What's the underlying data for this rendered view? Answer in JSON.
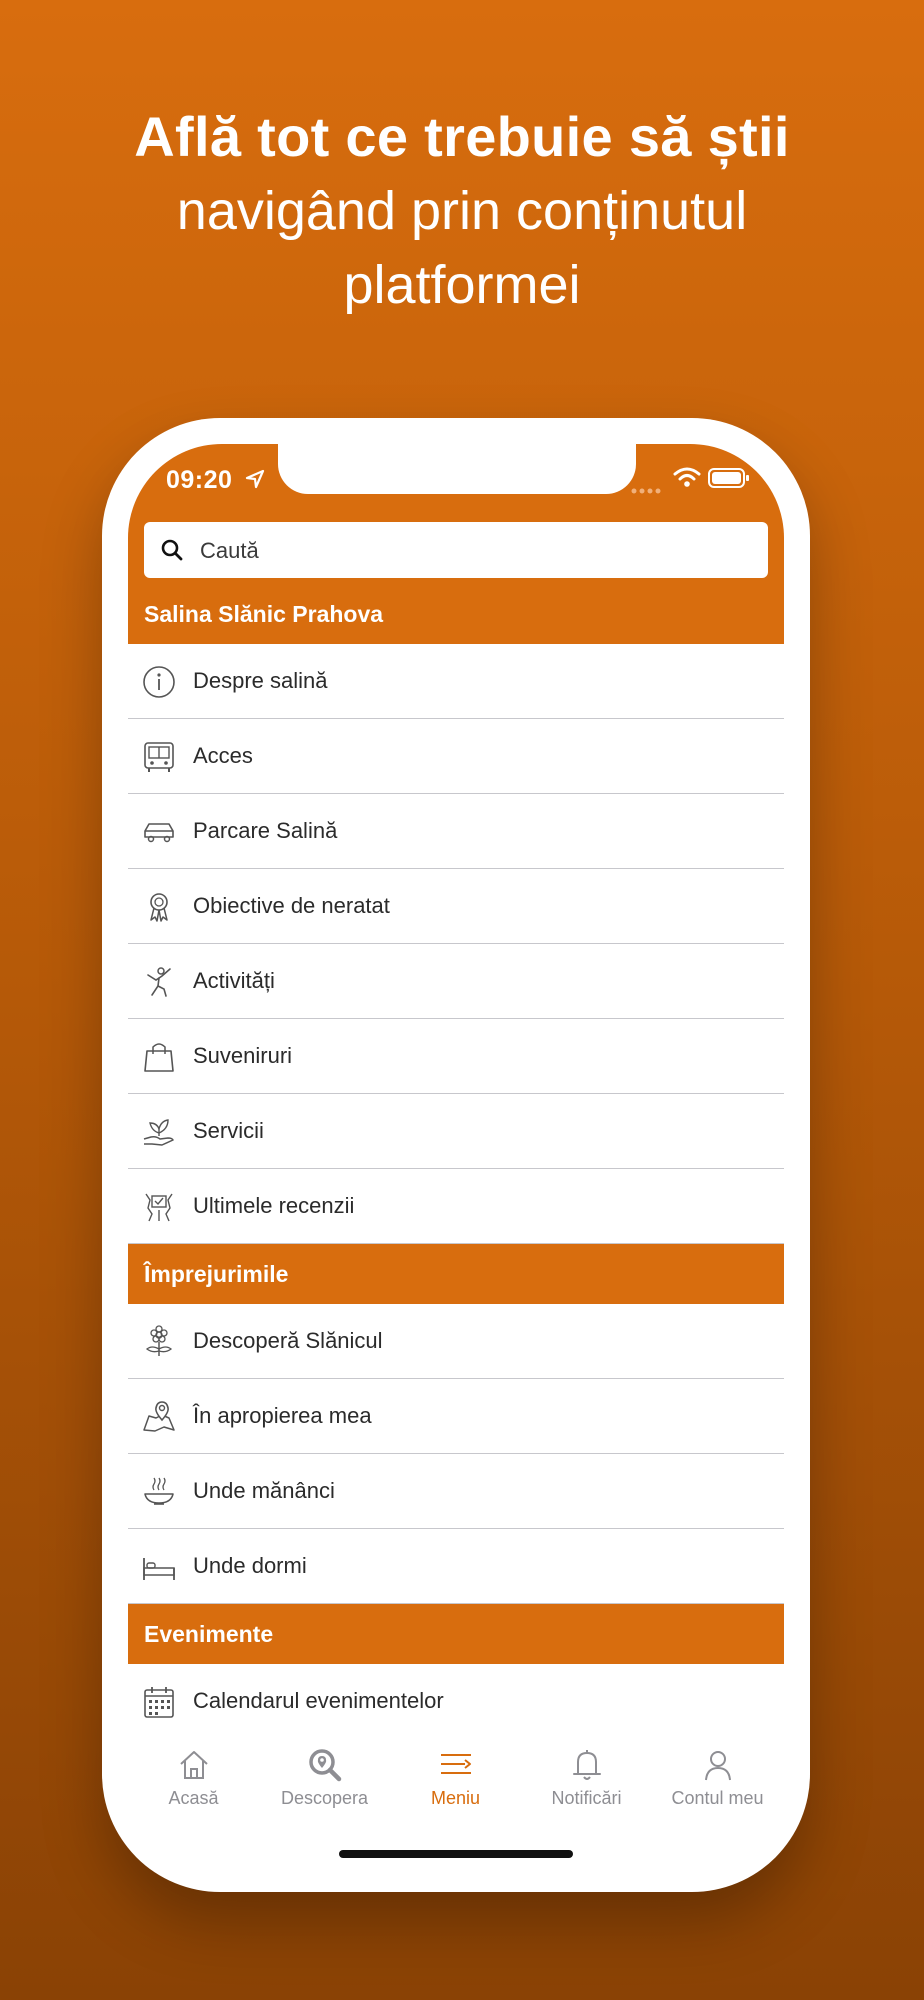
{
  "headline": {
    "line1": "Află tot ce trebuie să știi",
    "line2": "navigând prin conținutul",
    "line3": "platformei"
  },
  "status_bar": {
    "time": "09:20"
  },
  "search": {
    "placeholder": "Caută"
  },
  "menu": {
    "sections": [
      {
        "title": "Salina Slănic Prahova",
        "items": [
          {
            "label": "Despre salină",
            "icon": "info-icon"
          },
          {
            "label": "Acces",
            "icon": "bus-icon"
          },
          {
            "label": "Parcare Salină",
            "icon": "car-icon"
          },
          {
            "label": "Obiective de neratat",
            "icon": "award-ribbon-icon"
          },
          {
            "label": "Activități",
            "icon": "activity-person-icon"
          },
          {
            "label": "Suveniruri",
            "icon": "shopping-bag-icon"
          },
          {
            "label": "Servicii",
            "icon": "hand-plant-icon"
          },
          {
            "label": "Ultimele recenzii",
            "icon": "review-icon"
          }
        ]
      },
      {
        "title": "Împrejurimile",
        "items": [
          {
            "label": "Descoperă Slănicul",
            "icon": "flower-icon"
          },
          {
            "label": "În apropierea mea",
            "icon": "map-pin-icon"
          },
          {
            "label": "Unde mănânci",
            "icon": "food-bowl-icon"
          },
          {
            "label": "Unde dormi",
            "icon": "bed-icon"
          }
        ]
      },
      {
        "title": "Evenimente",
        "items": [
          {
            "label": "Calendarul evenimentelor",
            "icon": "calendar-icon"
          }
        ]
      }
    ]
  },
  "tabbar": {
    "tabs": [
      {
        "label": "Acasă",
        "icon": "home-icon"
      },
      {
        "label": "Descopera",
        "icon": "discover-search-icon"
      },
      {
        "label": "Meniu",
        "icon": "menu-icon",
        "active": true
      },
      {
        "label": "Notificări",
        "icon": "bell-icon"
      },
      {
        "label": "Contul meu",
        "icon": "user-icon"
      }
    ]
  },
  "colors": {
    "accent": "#d86d0e",
    "inactive": "#8e8e93",
    "separator": "#c7c7cc"
  }
}
